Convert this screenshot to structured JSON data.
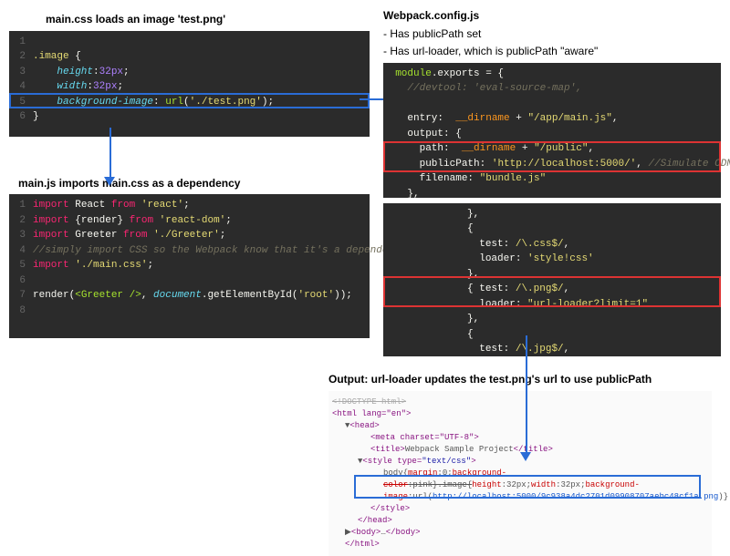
{
  "captions": {
    "css": "main.css loads an image 'test.png'",
    "js": "main.js imports main.css as a dependency",
    "webpack1": "Webpack.config.js",
    "webpack2": "- Has publicPath set",
    "webpack3": "- Has url-loader, which is publicPath \"aware\"",
    "output": "Output: url-loader updates the test.png's url to use publicPath"
  },
  "css_code": {
    "l2_sel": ".image",
    "l2_brace": " {",
    "l3_prop": "height",
    "l3_val": "32px",
    "l4_prop": "width",
    "l4_val": "32px",
    "l5_prop": "background-image",
    "l5_fn": "url",
    "l5_arg": "'./test.png'",
    "l6": "}"
  },
  "js_code": {
    "l1_kw": "import",
    "l1_id": "React",
    "l1_from": "from",
    "l1_str": "'react'",
    "l2_kw": "import",
    "l2_id": "{render}",
    "l2_from": "from",
    "l2_str": "'react-dom'",
    "l3_kw": "import",
    "l3_id": "Greeter",
    "l3_from": "from",
    "l3_str": "'./Greeter'",
    "l4_cmt": "//simply import CSS so the Webpack know that it's a dependency",
    "l5_kw": "import",
    "l5_str": "'./main.css'",
    "l7a": "render(",
    "l7b": "<Greeter />",
    "l7c": ", ",
    "l7d": "document",
    "l7e": ".getElementById(",
    "l7f": "'root'",
    "l7g": "));"
  },
  "wp_code": {
    "l1a": "module",
    "l1b": ".exports",
    "l1c": " = {",
    "l2": "//devtool: 'eval-source-map',",
    "l4a": "entry:",
    "l4b": "__dirname",
    "l4c": " + ",
    "l4d": "\"/app/main.js\"",
    "l4e": ",",
    "l5": "output: {",
    "l6a": "path:",
    "l6b": "__dirname",
    "l6c": " + ",
    "l6d": "\"/public\"",
    "l6e": ",",
    "l7a": "publicPath:",
    "l7b": "'http://localhost:5000/'",
    "l7c": ", ",
    "l7d": "//Simulate CDN",
    "l8a": "filename:",
    "l8b": "\"bundle.js\"",
    "l9": "},",
    "mA": "},",
    "mB": "{",
    "mCa": "test:",
    "mCb": "/\\.css$/",
    "mCc": ",",
    "mDa": "loader:",
    "mDb": "'style!css'",
    "mE": "},",
    "mFa": "{",
    "mFb": " test: ",
    "mFc": "/\\.png$/",
    "mFd": ",",
    "mGa": "loader:",
    "mGb": "\"url-loader?limit=1\"",
    "mH": "},",
    "mIa": "test:",
    "mIb": "/\\.jpg$/",
    "mIc": ","
  },
  "output_html": {
    "l0": "<!DOCTYPE html>",
    "l1": "<html lang=\"en\">",
    "l2": "<head>",
    "l3": "<meta charset=\"UTF-8\">",
    "l4a": "<title>",
    "l4b": "Webpack Sample Project",
    "l4c": "</title>",
    "l5a": "<style type=",
    "l5b": "\"text/css\"",
    "l5c": ">",
    "l6a": "body{",
    "l6b": "margin",
    "l6c": ":0;",
    "l6d": "background-",
    "l7a": "color",
    "l7b": ":pink}.image{",
    "l7c": "height",
    "l7d": ":32px;",
    "l7e": "width",
    "l7f": ":32px;",
    "l7g": "background-",
    "l8a": "image",
    "l8b": ":url(",
    "l8c": "http://localhost:5000/9c938a4dc2701d09908707aebc48cf1a.png",
    "l8d": ")}",
    "l9": "</style>",
    "l10": "</head>",
    "l11a": "<body>",
    "l11b": "…",
    "l11c": "</body>",
    "l12": "</html>"
  }
}
